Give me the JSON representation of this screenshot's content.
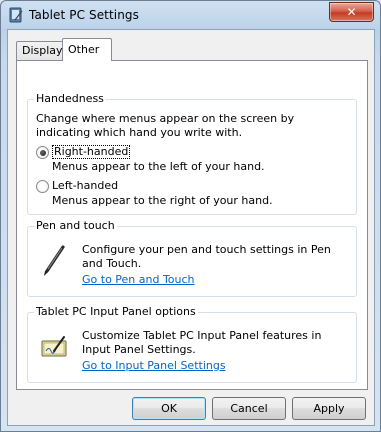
{
  "window": {
    "title": "Tablet PC Settings",
    "close_label": "✕"
  },
  "tabs": [
    {
      "label": "Display",
      "selected": false
    },
    {
      "label": "Other",
      "selected": true
    }
  ],
  "handedness": {
    "title": "Handedness",
    "description": "Change where menus appear on the screen by indicating which hand you write with.",
    "options": [
      {
        "label": "Right-handed",
        "sub": "Menus appear to the left of your hand.",
        "checked": true
      },
      {
        "label": "Left-handed",
        "sub": "Menus appear to the right of your hand.",
        "checked": false
      }
    ]
  },
  "pen_touch": {
    "title": "Pen and touch",
    "icon": "pen-icon",
    "description": "Configure your pen and touch settings in Pen and Touch.",
    "link": "Go to Pen and Touch"
  },
  "input_panel": {
    "title": "Tablet PC Input Panel options",
    "icon": "input-panel-icon",
    "description": "Customize Tablet PC Input Panel features in Input Panel Settings.",
    "link": "Go to Input Panel Settings"
  },
  "buttons": {
    "ok": "OK",
    "cancel": "Cancel",
    "apply": "Apply"
  }
}
